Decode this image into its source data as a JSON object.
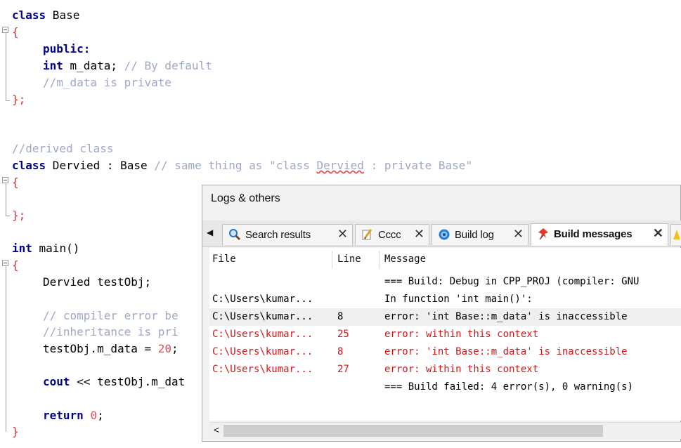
{
  "editor": {
    "lines": {
      "l1": {
        "kw": "class",
        "text": " Base"
      },
      "l2": {
        "brace": "{"
      },
      "l3": {
        "kw": "public",
        "punct": ":"
      },
      "l4": {
        "kw": "int",
        "text": " m_data;",
        "comment": " // By default"
      },
      "l5": {
        "comment": "//m_data is private"
      },
      "l6": {
        "brace": "};"
      },
      "l7": {
        "comment": "//derived class"
      },
      "l8": {
        "kw": "class",
        "text": " Dervied : Base",
        "comment_a": " // same thing as \"class ",
        "comment_sq": "Dervied",
        "comment_b": " : private Base\""
      },
      "l9": {
        "brace": "{"
      },
      "l10": {
        "brace": "};"
      },
      "l11": {
        "kw": "int",
        "text": " main()"
      },
      "l12": {
        "brace": "{"
      },
      "l13": {
        "text": "Dervied testObj;"
      },
      "l14": {
        "comment": "// compiler error be"
      },
      "l15": {
        "comment": "//inheritance is pri"
      },
      "l16": {
        "text": "testObj.m_data = ",
        "num": "20",
        "punct": ";"
      },
      "l17": {
        "kw": "cout",
        "text": " << testObj.m_dat"
      },
      "l18": {
        "kw": "return",
        "text": " ",
        "num": "0",
        "punct": ";"
      },
      "l19": {
        "brace": "}"
      }
    }
  },
  "logs": {
    "title": "Logs & others",
    "tabs": {
      "search": {
        "label": "Search results",
        "icon": "magnifier-icon",
        "close": "✕"
      },
      "cccc": {
        "label": "Cccc",
        "icon": "notepad-pencil-icon",
        "close": "✕"
      },
      "buildlog": {
        "label": "Build log",
        "icon": "gear-cog-icon",
        "close": "✕"
      },
      "buildmsg": {
        "label": "Build messages",
        "icon": "pin-icon",
        "close": "✕"
      }
    },
    "scroll_left": "◀",
    "columns": {
      "file": "File",
      "line": "Line",
      "message": "Message"
    },
    "rows": [
      {
        "file": "",
        "line": "",
        "message": "=== Build: Debug in CPP_PROJ (compiler: GNU"
      },
      {
        "file": "C:\\Users\\kumar...",
        "line": "",
        "message": "In function 'int main()':"
      },
      {
        "file": "C:\\Users\\kumar...",
        "line": "8",
        "message": "error: 'int Base::m_data' is inaccessible"
      },
      {
        "file": "C:\\Users\\kumar...",
        "line": "25",
        "message": "error: within this context"
      },
      {
        "file": "C:\\Users\\kumar...",
        "line": "8",
        "message": "error: 'int Base::m_data' is inaccessible"
      },
      {
        "file": "C:\\Users\\kumar...",
        "line": "27",
        "message": "error: within this context"
      },
      {
        "file": "",
        "line": "",
        "message": "=== Build failed: 4 error(s), 0 warning(s)"
      }
    ],
    "hscroll_left": "<"
  },
  "colors": {
    "keyword": "#00008b",
    "comment": "#a0a8c8",
    "number": "#e05050",
    "error": "#d01818"
  }
}
